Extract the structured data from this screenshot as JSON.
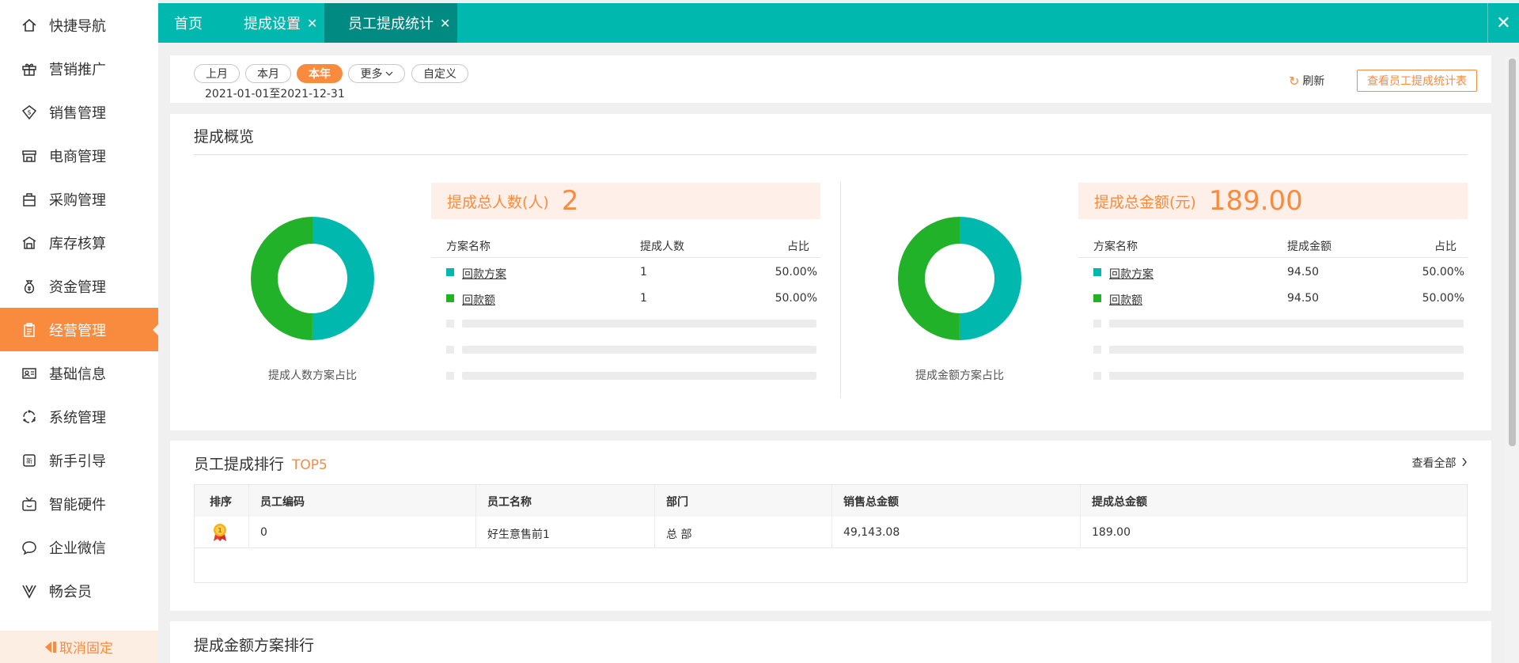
{
  "sidebar": {
    "items": [
      {
        "label": "快捷导航",
        "icon": "home-icon"
      },
      {
        "label": "营销推广",
        "icon": "gift-icon"
      },
      {
        "label": "销售管理",
        "icon": "sales-icon"
      },
      {
        "label": "电商管理",
        "icon": "store-icon"
      },
      {
        "label": "采购管理",
        "icon": "bag-icon"
      },
      {
        "label": "库存核算",
        "icon": "warehouse-icon"
      },
      {
        "label": "资金管理",
        "icon": "money-bag-icon"
      },
      {
        "label": "经营管理",
        "icon": "clipboard-icon"
      },
      {
        "label": "基础信息",
        "icon": "id-card-icon"
      },
      {
        "label": "系统管理",
        "icon": "system-icon"
      },
      {
        "label": "新手引导",
        "icon": "new-icon"
      },
      {
        "label": "智能硬件",
        "icon": "tv-icon"
      },
      {
        "label": "企业微信",
        "icon": "chat-icon"
      },
      {
        "label": "畅会员",
        "icon": "vip-icon"
      }
    ],
    "active_index": 7,
    "unpin_label": "取消固定"
  },
  "tabs": [
    {
      "label": "首页",
      "closable": false
    },
    {
      "label": "提成设置",
      "closable": true
    },
    {
      "label": "员工提成统计",
      "closable": true
    }
  ],
  "tab_close_glyph": "✕",
  "filter": {
    "chips": [
      "上月",
      "本月",
      "本年",
      "更多",
      "自定义"
    ],
    "active": "本年",
    "date_range": "2021-01-01至2021-12-31",
    "refresh_label": "刷新",
    "view_table_label": "查看员工提成统计表"
  },
  "overview": {
    "title": "提成概览",
    "left": {
      "caption": "提成人数方案占比",
      "stat_label": "提成总人数(人)",
      "stat_value": "2",
      "headers": [
        "方案名称",
        "提成人数",
        "占比"
      ],
      "rows": [
        {
          "name": "回款方案",
          "value": "1",
          "pct": "50.00%",
          "color": "#00b8ad"
        },
        {
          "name": "回款额",
          "value": "1",
          "pct": "50.00%",
          "color": "#22b22a"
        }
      ],
      "donut": [
        {
          "value": 50,
          "color": "#00b8ad"
        },
        {
          "value": 50,
          "color": "#22b22a"
        }
      ]
    },
    "right": {
      "caption": "提成金额方案占比",
      "stat_label": "提成总金额(元)",
      "stat_value": "189.00",
      "headers": [
        "方案名称",
        "提成金额",
        "占比"
      ],
      "rows": [
        {
          "name": "回款方案",
          "value": "94.50",
          "pct": "50.00%",
          "color": "#00b8ad"
        },
        {
          "name": "回款额",
          "value": "94.50",
          "pct": "50.00%",
          "color": "#22b22a"
        }
      ],
      "donut": [
        {
          "value": 50,
          "color": "#00b8ad"
        },
        {
          "value": 50,
          "color": "#22b22a"
        }
      ]
    }
  },
  "ranking": {
    "title": "员工提成排行",
    "badge": "TOP5",
    "view_all": "查看全部",
    "headers": [
      "排序",
      "员工编码",
      "员工名称",
      "部门",
      "销售总金额",
      "提成总金额"
    ],
    "rows": [
      {
        "code": "0",
        "name": "好生意售前1",
        "dept": "总 部",
        "sales": "49,143.08",
        "commission": "189.00"
      }
    ]
  },
  "bottom": {
    "title": "提成金额方案排行"
  }
}
